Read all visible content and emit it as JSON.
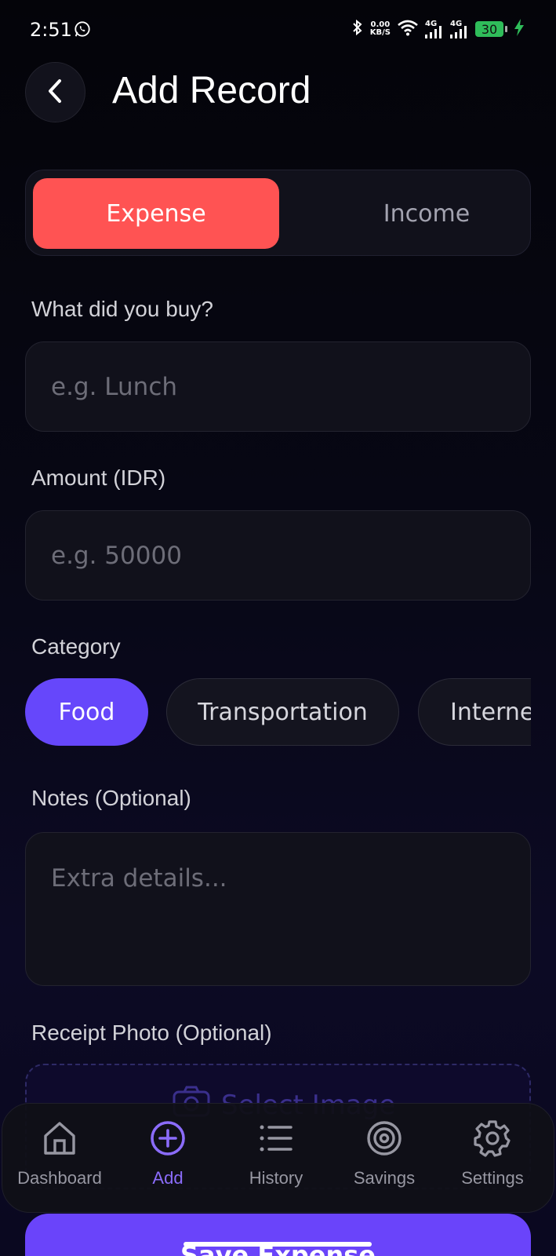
{
  "status_bar": {
    "time": "2:51",
    "net_speed_value": "0.00",
    "net_speed_unit": "KB/S",
    "signal_1": "4G",
    "signal_2": "4G",
    "battery": "30"
  },
  "header": {
    "title": "Add Record"
  },
  "type_toggle": {
    "expense_label": "Expense",
    "income_label": "Income",
    "selected": "Expense"
  },
  "form": {
    "item_label": "What did you buy?",
    "item_placeholder": "e.g. Lunch",
    "amount_label": "Amount (IDR)",
    "amount_placeholder": "e.g. 50000",
    "category_label": "Category",
    "categories": [
      "Food",
      "Transportation",
      "Internet"
    ],
    "selected_category": "Food",
    "notes_label": "Notes (Optional)",
    "notes_placeholder": "Extra details...",
    "receipt_label": "Receipt Photo (Optional)",
    "select_image_label": "Select Image"
  },
  "save_button": {
    "label": "Save Expense"
  },
  "bottom_nav": {
    "items": [
      {
        "label": "Dashboard",
        "icon": "home-icon"
      },
      {
        "label": "Add",
        "icon": "plus-circle-icon"
      },
      {
        "label": "History",
        "icon": "list-icon"
      },
      {
        "label": "Savings",
        "icon": "target-icon"
      },
      {
        "label": "Settings",
        "icon": "gear-icon"
      }
    ],
    "active": "Add"
  },
  "colors": {
    "accent": "#6647fb",
    "expense": "#ff5353",
    "battery": "#2fbd5a"
  }
}
